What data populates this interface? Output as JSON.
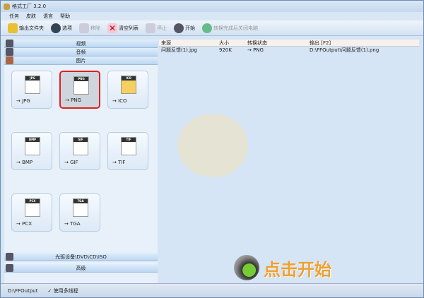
{
  "title": "格式工厂 3.2.0",
  "menu": [
    "任务",
    "皮肤",
    "语言",
    "帮助"
  ],
  "toolbar": {
    "output_folder": "输出文件夹",
    "options": "选项",
    "remove": "移除",
    "clear": "清空列表",
    "stop": "停止",
    "start": "开始",
    "shutdown": "转换完成后关闭电脑"
  },
  "categories": {
    "video": "视频",
    "audio": "音频",
    "image": "图片",
    "rom": "光驱设备\\DVD\\CD\\ISO",
    "advanced": "高级"
  },
  "tiles": [
    "→ JPG",
    "→ PNG",
    "→ ICO",
    "→ BMP",
    "→ GIF",
    "→ TIF",
    "→ PCX",
    "→ TGA"
  ],
  "tile_badges": [
    "JPG",
    "PNG",
    "ICO",
    "BMP",
    "GIF",
    "TIF",
    "PCX",
    "TGA"
  ],
  "table": {
    "headers": [
      "来源",
      "大小",
      "转换状态",
      "输出 [F2]"
    ],
    "rows": [
      {
        "source": "问题反馈(1).jpg",
        "size": "920K",
        "status": "→ PNG",
        "output": "D:\\FFOutput\\问题反馈(1).png"
      }
    ]
  },
  "start_label": "点击开始",
  "status": {
    "path": "D:\\FFOutput",
    "multithread": "使用多线程"
  }
}
